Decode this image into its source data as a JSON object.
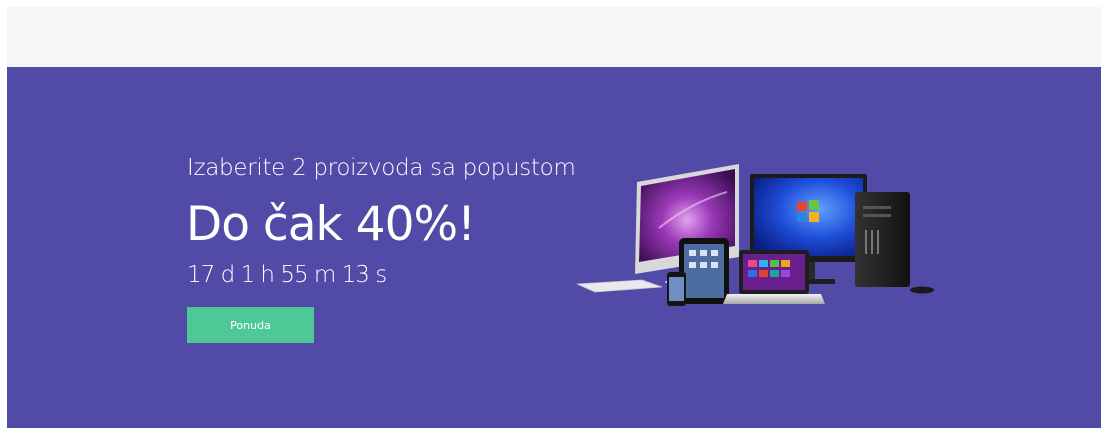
{
  "hero": {
    "subtitle": "Izaberite 2 proizvoda sa popustom",
    "headline": "Do čak 40%!",
    "countdown": "17 d 1 h 55 m 13 s",
    "cta_label": "Ponuda"
  },
  "colors": {
    "topbar": "#f6f6f6",
    "banner": "#514aa6",
    "cta": "#4ec896",
    "text": "#ffffff"
  },
  "icons": {
    "hero_image": "devices-illustration"
  }
}
